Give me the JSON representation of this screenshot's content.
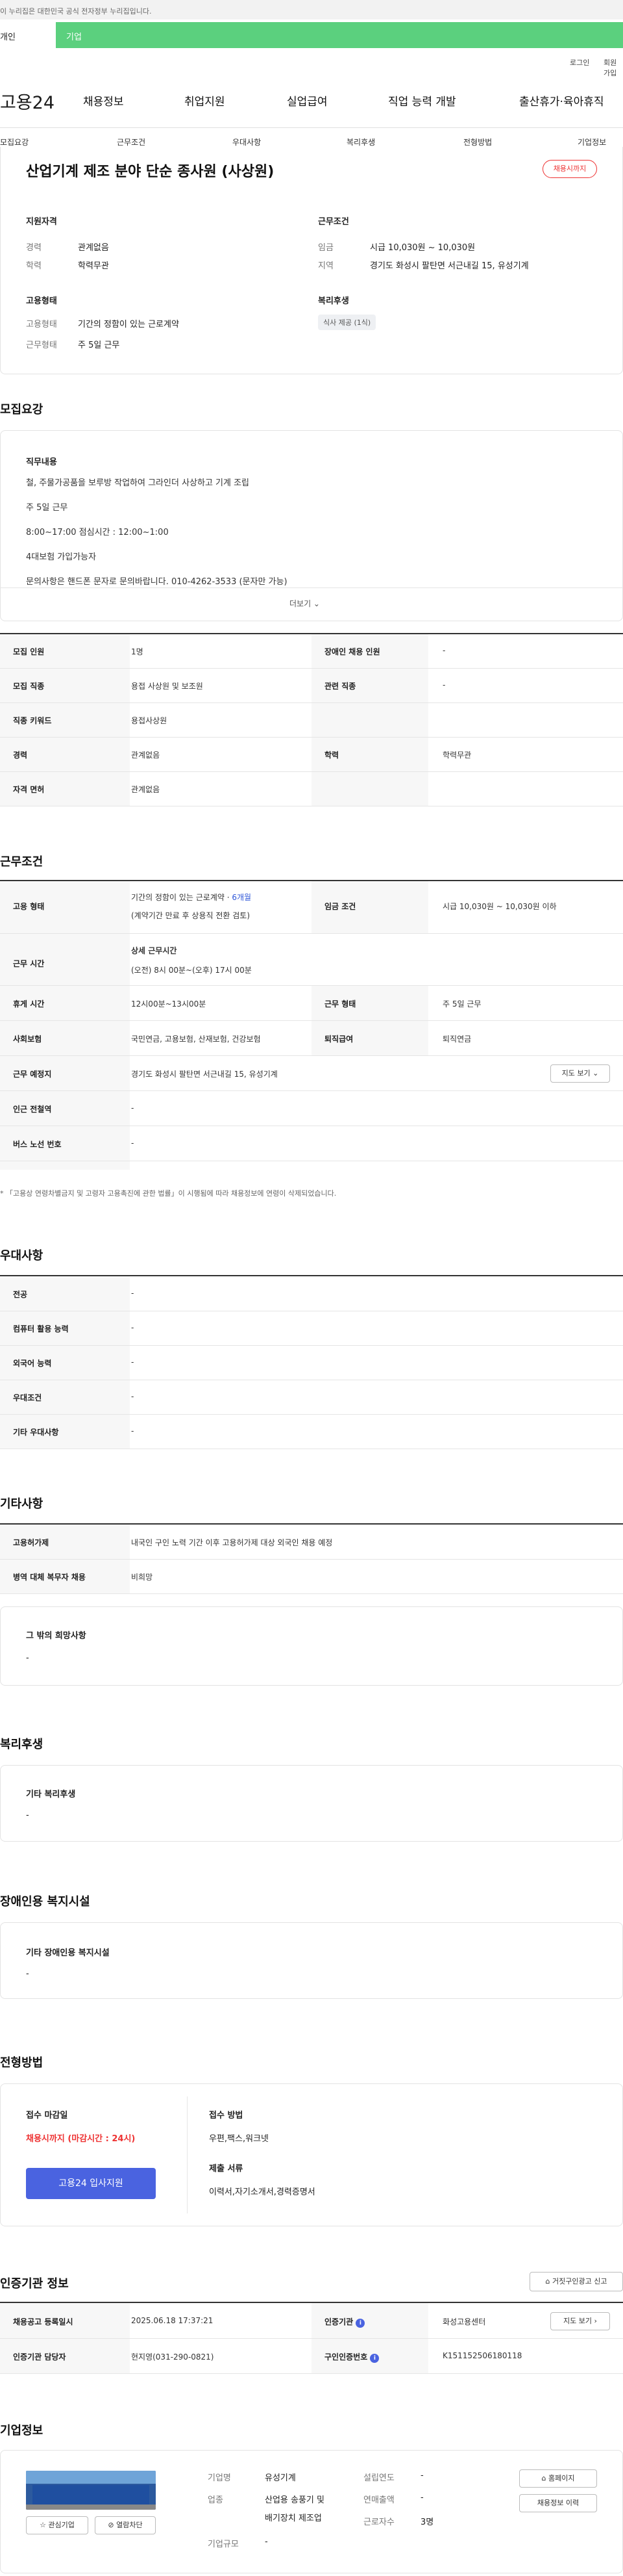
{
  "topbar": {
    "notice": "이 누리집은 대한민국 공식 전자정부 누리집입니다."
  },
  "tabs": {
    "personal": "개인",
    "company": "기업"
  },
  "util": {
    "login": "로그인",
    "join": "회원가입"
  },
  "brand": {
    "logo": "고용24"
  },
  "gnb": [
    "채용정보",
    "취업지원",
    "실업급여",
    "직업 능력 개발",
    "출산휴가·육아휴직"
  ],
  "subnav": [
    "모집요강",
    "근무조건",
    "우대사항",
    "복리후생",
    "전형방법",
    "기업정보"
  ],
  "job": {
    "title": "산업기계 제조 분야 단순 종사원 (사상원)",
    "deadline_badge": "채용시까지"
  },
  "summary": {
    "qual_title": "지원자격",
    "career_k": "경력",
    "career_v": "관계없음",
    "edu_k": "학력",
    "edu_v": "학력무관",
    "cond_title": "근무조건",
    "wage_k": "임금",
    "wage_v": "시급 10,030원 ~ 10,030원",
    "region_k": "지역",
    "region_v": "경기도 화성시 팔탄면 서근내길 15, 유성기계",
    "emp_title": "고용형태",
    "emptype_k": "고용형태",
    "emptype_v": "기간의 정함이 있는 근로계약",
    "days_k": "근무형태",
    "days_v": "주 5일 근무",
    "welfare_title": "복리후생",
    "welfare_chip": "식사 제공 (1식)"
  },
  "recruit": {
    "section": "모집요강",
    "duty_title": "직무내용",
    "lines": [
      "철, 주물가공품을 보루방 작업하여 그라인더 사상하고 기계 조립",
      "주 5일 근무",
      "8:00~17:00 점심시간 : 12:00~1:00",
      "4대보험 가입가능자",
      "문의사항은 핸드폰 문자로 문의바랍니다. 010-4262-3533 (문자만 가능)"
    ],
    "more": "더보기 ⌄",
    "rows": [
      {
        "k1": "모집 인원",
        "v1": "1명",
        "k2": "장애인 채용 인원",
        "v2": "-"
      },
      {
        "k1": "모집 직종",
        "v1": "용접 사상원 및 보조원",
        "k2": "관련 직종",
        "v2": "-"
      },
      {
        "k1": "직종 키워드",
        "v1": "용접사상원",
        "k2": "",
        "v2": ""
      },
      {
        "k1": "경력",
        "v1": "관계없음",
        "k2": "학력",
        "v2": "학력무관"
      },
      {
        "k1": "자격 면허",
        "v1": "관계없음",
        "k2": "",
        "v2": ""
      }
    ]
  },
  "work": {
    "section": "근무조건",
    "emp_k": "고용 형태",
    "emp_v1": "기간의 정함이 있는 근로계약 · ",
    "emp_months": "6개월",
    "emp_v2": "(계약기간 만료 후 상용직 전환 검토)",
    "wage_k": "임금 조건",
    "wage_v": "시급 10,030원 ~ 10,030원 이하",
    "time_k": "근무 시간",
    "time_title": "상세 근무시간",
    "time_v": "(오전) 8시 00분~(오후) 17시 00분",
    "rest_k": "휴게 시간",
    "rest_v": "12시00분~13시00분",
    "form_k": "근무 형태",
    "form_v": "주 5일 근무",
    "ins_k": "사회보험",
    "ins_v": "국민연금, 고용보험, 산재보험, 건강보험",
    "sev_k": "퇴직급여",
    "sev_v": "퇴직연금",
    "place_k": "근무 예정지",
    "place_v": "경기도 화성시 팔탄면 서근내길 15, 유성기계",
    "map_btn": "지도 보기 ⌄",
    "subway_k": "인근 전철역",
    "subway_v": "-",
    "bus_k": "버스 노선 번호",
    "bus_v": "-",
    "note": "* 「고용상 연령차별금지 및 고령자 고용촉진에 관한 법률」이 시행됨에 따라 채용정보에 연령이 삭제되었습니다."
  },
  "pref": {
    "section": "우대사항",
    "rows": [
      {
        "k": "전공",
        "v": "-"
      },
      {
        "k": "컴퓨터 활용 능력",
        "v": "-"
      },
      {
        "k": "외국어 능력",
        "v": "-"
      },
      {
        "k": "우대조건",
        "v": "-"
      },
      {
        "k": "기타 우대사항",
        "v": "-"
      }
    ]
  },
  "etc": {
    "section": "기타사항",
    "rows": [
      {
        "k": "고용허가제",
        "v": "내국인 구인 노력 기간 이후 고용허가제 대상 외국인 채용 예정"
      },
      {
        "k": "병역 대체 복무자 채용",
        "v": "비희망"
      }
    ],
    "other_title": "그 밖의 희망사항",
    "other_v": "-"
  },
  "welfare": {
    "section": "복리후생",
    "title": "기타 복리후생",
    "v": "-"
  },
  "disabled": {
    "section": "장애인용 복지시설",
    "title": "기타 장애인용 복지시설",
    "v": "-"
  },
  "process": {
    "section": "전형방법",
    "deadline_k": "접수 마감일",
    "deadline_v": "채용시까지 (마감시간 : 24시)",
    "apply_btn": "고용24 입사지원",
    "method_k": "접수 방법",
    "method_v": "우편,팩스,워크넷",
    "docs_k": "제출 서류",
    "docs_v": "이력서,자기소개서,경력증명서"
  },
  "agency": {
    "section": "인증기관 정보",
    "report_btn": "거짓구인광고 신고",
    "reg_k": "채용공고 등록일시",
    "reg_v": "2025.06.18 17:37:21",
    "org_k": "인증기관",
    "org_v": "화성고용센터",
    "map_btn": "지도 보기",
    "mgr_k": "인증기관 담당자",
    "mgr_v": "현지영(031-290-0821)",
    "num_k": "구인인증번호",
    "num_v": "K151152506180118"
  },
  "company": {
    "section": "기업정보",
    "name_k": "기업명",
    "name_v": "유성기계",
    "ind_k": "업종",
    "ind_v1": "산업용 송풍기 및",
    "ind_v2": "배기장치 제조업",
    "size_k": "기업규모",
    "size_v": "-",
    "year_k": "설립연도",
    "year_v": "-",
    "sales_k": "연매출액",
    "sales_v": "-",
    "emp_k": "근로자수",
    "emp_v": "3명",
    "home_btn": "홈페이지",
    "hist_btn": "채용정보 이력",
    "fav_btn": "☆ 관심기업",
    "block_btn": "⊘ 열람차단"
  },
  "colors": {
    "brand_green": "#5bd07e",
    "accent_blue": "#4a63e0",
    "alert_red": "#e33333"
  }
}
